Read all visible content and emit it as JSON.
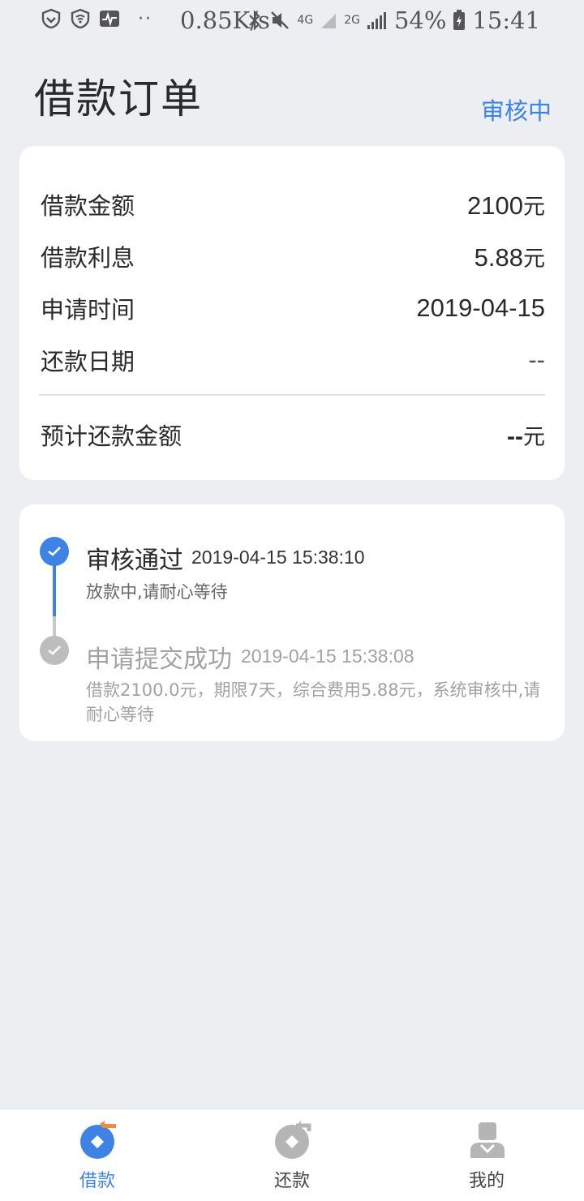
{
  "status_bar": {
    "net_speed": "0.85K/s",
    "network_4g": "4G",
    "network_2g": "2G",
    "battery": "54%",
    "time": "15:41",
    "icons": [
      "shield-icon",
      "wifi-icon",
      "activity-icon",
      "more-dots-icon",
      "bluetooth-icon",
      "mute-icon",
      "signal-icon",
      "battery-icon"
    ]
  },
  "header": {
    "title": "借款订单",
    "status": "审核中"
  },
  "loan_info": {
    "rows": [
      {
        "label": "借款金额",
        "value": "2100",
        "unit": "元"
      },
      {
        "label": "借款利息",
        "value": "5.88",
        "unit": "元"
      },
      {
        "label": "申请时间",
        "value": "2019-04-15"
      },
      {
        "label": "还款日期",
        "value": "--"
      }
    ],
    "total": {
      "label": "预计还款金额",
      "value": "--",
      "unit": "元"
    }
  },
  "timeline": [
    {
      "title": "审核通过",
      "time": "2019-04-15 15:38:10",
      "desc": "放款中,请耐心等待",
      "state": "active"
    },
    {
      "title": "申请提交成功",
      "time": "2019-04-15 15:38:08",
      "desc": "借款2100.0元，期限7天，综合费用5.88元，系统审核中,请耐心等待",
      "state": "done"
    }
  ],
  "bottom_nav": [
    {
      "label": "借款",
      "icon": "borrow-icon",
      "active": true
    },
    {
      "label": "还款",
      "icon": "repay-icon",
      "active": false
    },
    {
      "label": "我的",
      "icon": "profile-icon",
      "active": false
    }
  ],
  "colors": {
    "accent": "#3d83e6",
    "orange": "#f08a3c",
    "background": "#eceef2",
    "inactive_icon": "#b5b5b5"
  }
}
